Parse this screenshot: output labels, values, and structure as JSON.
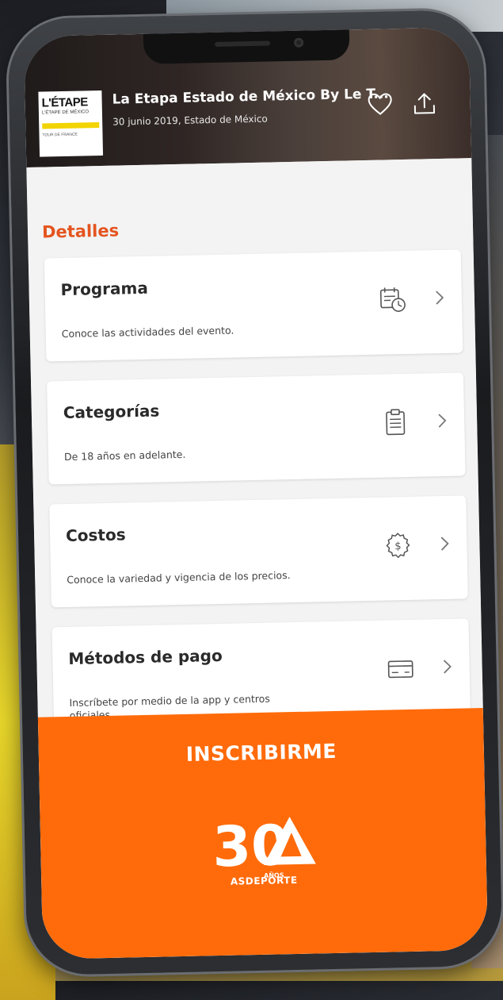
{
  "event": {
    "logo": {
      "title": "L'ÉTAPE",
      "subtitle": "L'ÉTAPE DE MÉXICO",
      "tag": "TOUR DE FRANCE"
    },
    "title": "La Etapa Estado de México By Le T...",
    "subtitle": "30 junio 2019, Estado de México",
    "icons": [
      "heart-icon",
      "share-icon"
    ]
  },
  "details": {
    "section_title": "Detalles",
    "cards": [
      {
        "title": "Programa",
        "description": "Conoce las actividades del evento.",
        "icon": "calendar-clock-icon"
      },
      {
        "title": "Categorías",
        "description": "De 18 años en adelante.",
        "icon": "clipboard-icon"
      },
      {
        "title": "Costos",
        "description": "Conoce la variedad y vigencia de los precios.",
        "icon": "dollar-coin-icon"
      },
      {
        "title": "Métodos de pago",
        "description": "Inscríbete por medio de la app y centros oficiales.",
        "icon": "credit-card-icon"
      }
    ]
  },
  "cta": {
    "label": "INSCRIBIRME",
    "brand": {
      "number": "30",
      "years": "AÑOS",
      "name": "ASDEPORTE"
    }
  },
  "colors": {
    "accent": "#e4541f",
    "cta": "#ff6b0a",
    "card": "#ffffff"
  }
}
